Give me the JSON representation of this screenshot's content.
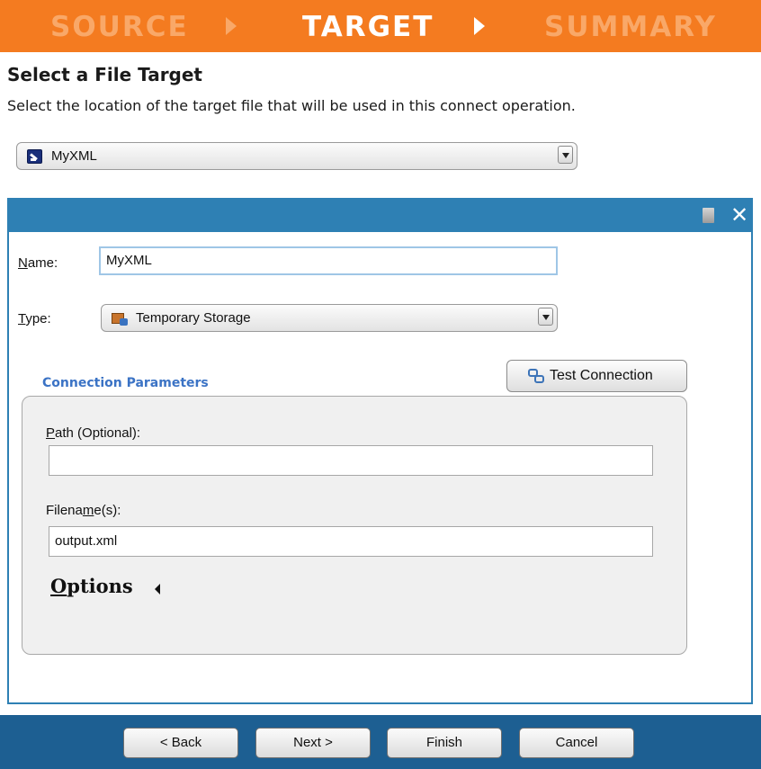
{
  "wizard": {
    "steps": [
      {
        "label": "SOURCE",
        "active": false
      },
      {
        "label": "TARGET",
        "active": true
      },
      {
        "label": "SUMMARY",
        "active": false
      }
    ],
    "colors": {
      "header_bg": "#f47b20",
      "active_text": "#ffffff",
      "inactive_text": "#f9a868"
    }
  },
  "header": {
    "title": "Select a File Target",
    "description": "Select the location of the target file that will be used in this connect operation."
  },
  "target_select": {
    "icon": "xml-file-icon",
    "value": "MyXML"
  },
  "panel": {
    "colors": {
      "bar": "#2e80b4"
    },
    "toolbar_icons": [
      "document-icon",
      "close-icon"
    ],
    "close_glyph": "✕",
    "name": {
      "label_first": "N",
      "label_rest": "ame:",
      "value": "MyXML"
    },
    "type": {
      "label_first": "T",
      "label_rest": "ype:",
      "icon": "storage-icon",
      "value": "Temporary Storage"
    },
    "connection": {
      "title": "Connection Parameters",
      "test_button": "Test Connection",
      "test_icon": "link-icon",
      "path": {
        "label_first": "P",
        "label_rest": "ath (Optional):",
        "value": ""
      },
      "filename": {
        "label_prefix": "Filena",
        "label_underlined": "m",
        "label_suffix": "e(s):",
        "value": "output.xml"
      },
      "options": {
        "label_first": "O",
        "label_rest": "ptions"
      }
    }
  },
  "footer": {
    "colors": {
      "bg": "#1d5f92"
    },
    "back": "< Back",
    "next": "Next >",
    "finish": "Finish",
    "cancel": "Cancel"
  }
}
